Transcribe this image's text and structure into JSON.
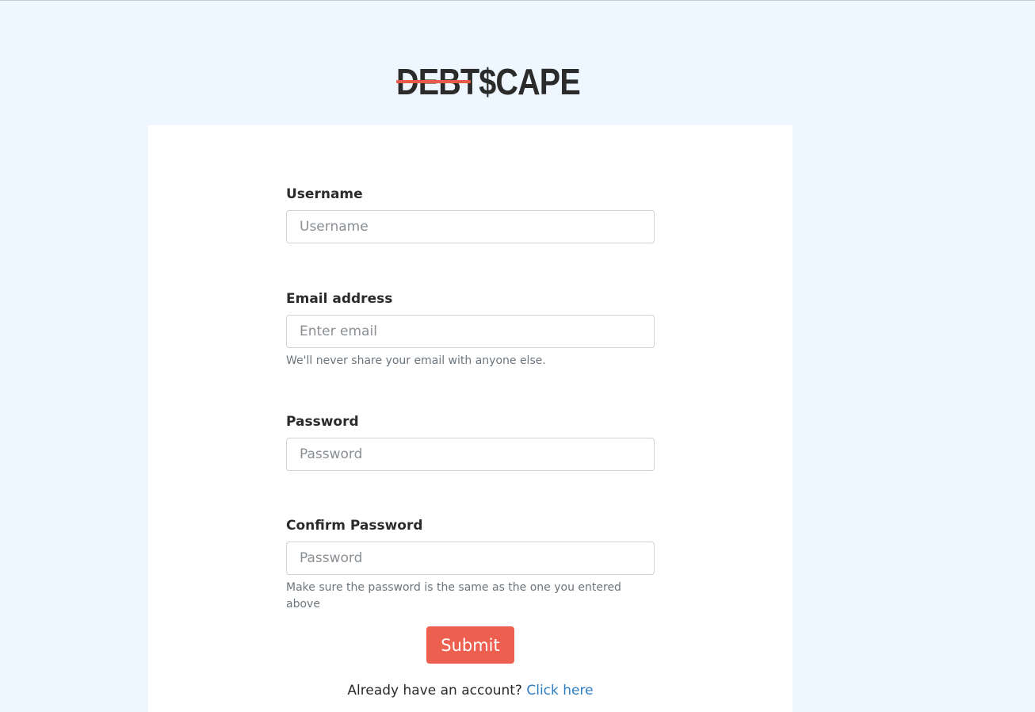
{
  "brand": {
    "logo_text": "DEBT$CAPE",
    "logo_accent_color": "#ea5a47"
  },
  "form": {
    "username": {
      "label": "Username",
      "placeholder": "Username"
    },
    "email": {
      "label": "Email address",
      "placeholder": "Enter email",
      "help": "We'll never share your email with anyone else."
    },
    "password": {
      "label": "Password",
      "placeholder": "Password"
    },
    "confirm_password": {
      "label": "Confirm Password",
      "placeholder": "Password",
      "help": "Make sure the password is the same as the one you entered above"
    },
    "submit_label": "Submit",
    "submit_color": "#ed5f4e"
  },
  "footer": {
    "prompt": "Already have an account?",
    "link_text": "Click here"
  }
}
